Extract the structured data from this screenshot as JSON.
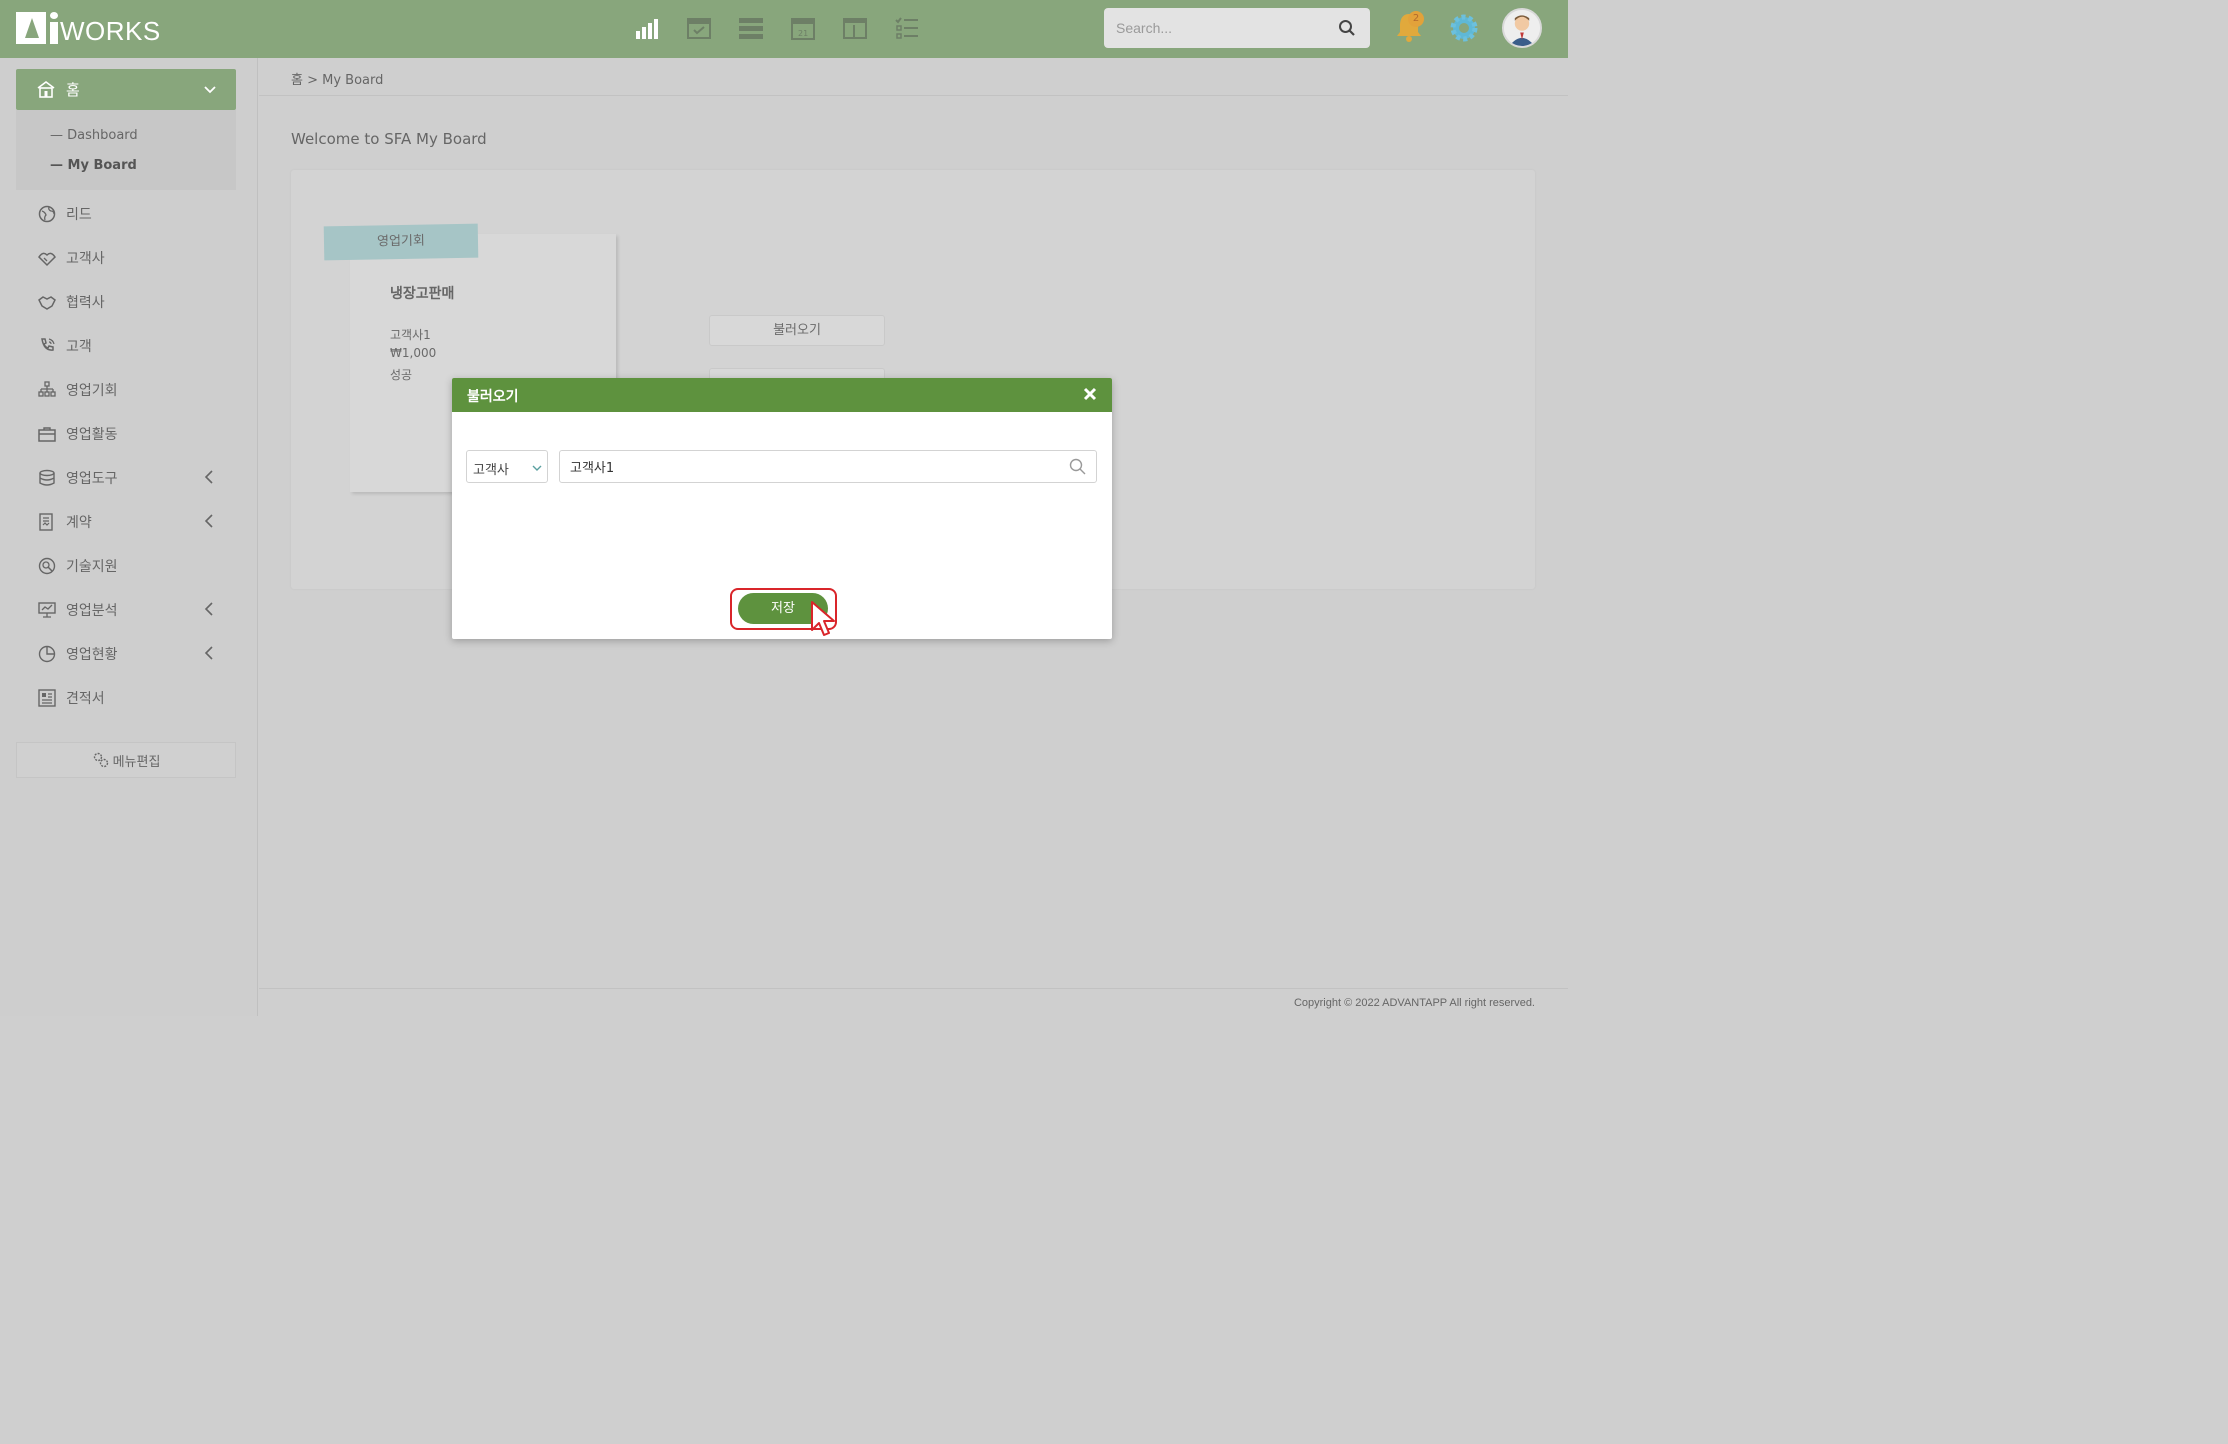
{
  "header": {
    "logo_text": "WORKS",
    "search_placeholder": "Search...",
    "notification_count": "2",
    "toolbar_icons": [
      "chart-icon",
      "calendar-check-icon",
      "list-icon",
      "calendar-icon",
      "panel-icon",
      "checklist-icon"
    ],
    "accent_color": "#88a67c"
  },
  "sidebar": {
    "home_label": "홈",
    "sub_items": [
      {
        "label": "— Dashboard"
      },
      {
        "label": "— My Board"
      }
    ],
    "items": [
      {
        "label": "리드",
        "icon": "globe-icon"
      },
      {
        "label": "고객사",
        "icon": "handshake-icon"
      },
      {
        "label": "협력사",
        "icon": "partner-icon"
      },
      {
        "label": "고객",
        "icon": "phone-icon"
      },
      {
        "label": "영업기회",
        "icon": "org-icon"
      },
      {
        "label": "영업활동",
        "icon": "briefcase-icon"
      },
      {
        "label": "영업도구",
        "icon": "database-icon"
      },
      {
        "label": "계약",
        "icon": "contract-icon"
      },
      {
        "label": "기술지원",
        "icon": "support-icon"
      },
      {
        "label": "영업분석",
        "icon": "presentation-icon"
      },
      {
        "label": "영업현황",
        "icon": "piechart-icon"
      },
      {
        "label": "견적서",
        "icon": "quote-icon"
      }
    ],
    "menu_edit_label": "메뉴편집"
  },
  "main": {
    "breadcrumb": "홈 > My Board",
    "welcome": "Welcome to SFA My Board",
    "note": {
      "tag": "영업기회",
      "title": "냉장고판매",
      "lines": [
        "고객사1",
        "₩1,000",
        "성공"
      ]
    },
    "load_button": "불러오기",
    "copyright": "Copyright © 2022 ADVANTAPP All right reserved."
  },
  "modal": {
    "title": "불러오기",
    "select_value": "고객사",
    "search_value": "고객사1",
    "save_label": "저장",
    "header_color": "#5e923e"
  }
}
